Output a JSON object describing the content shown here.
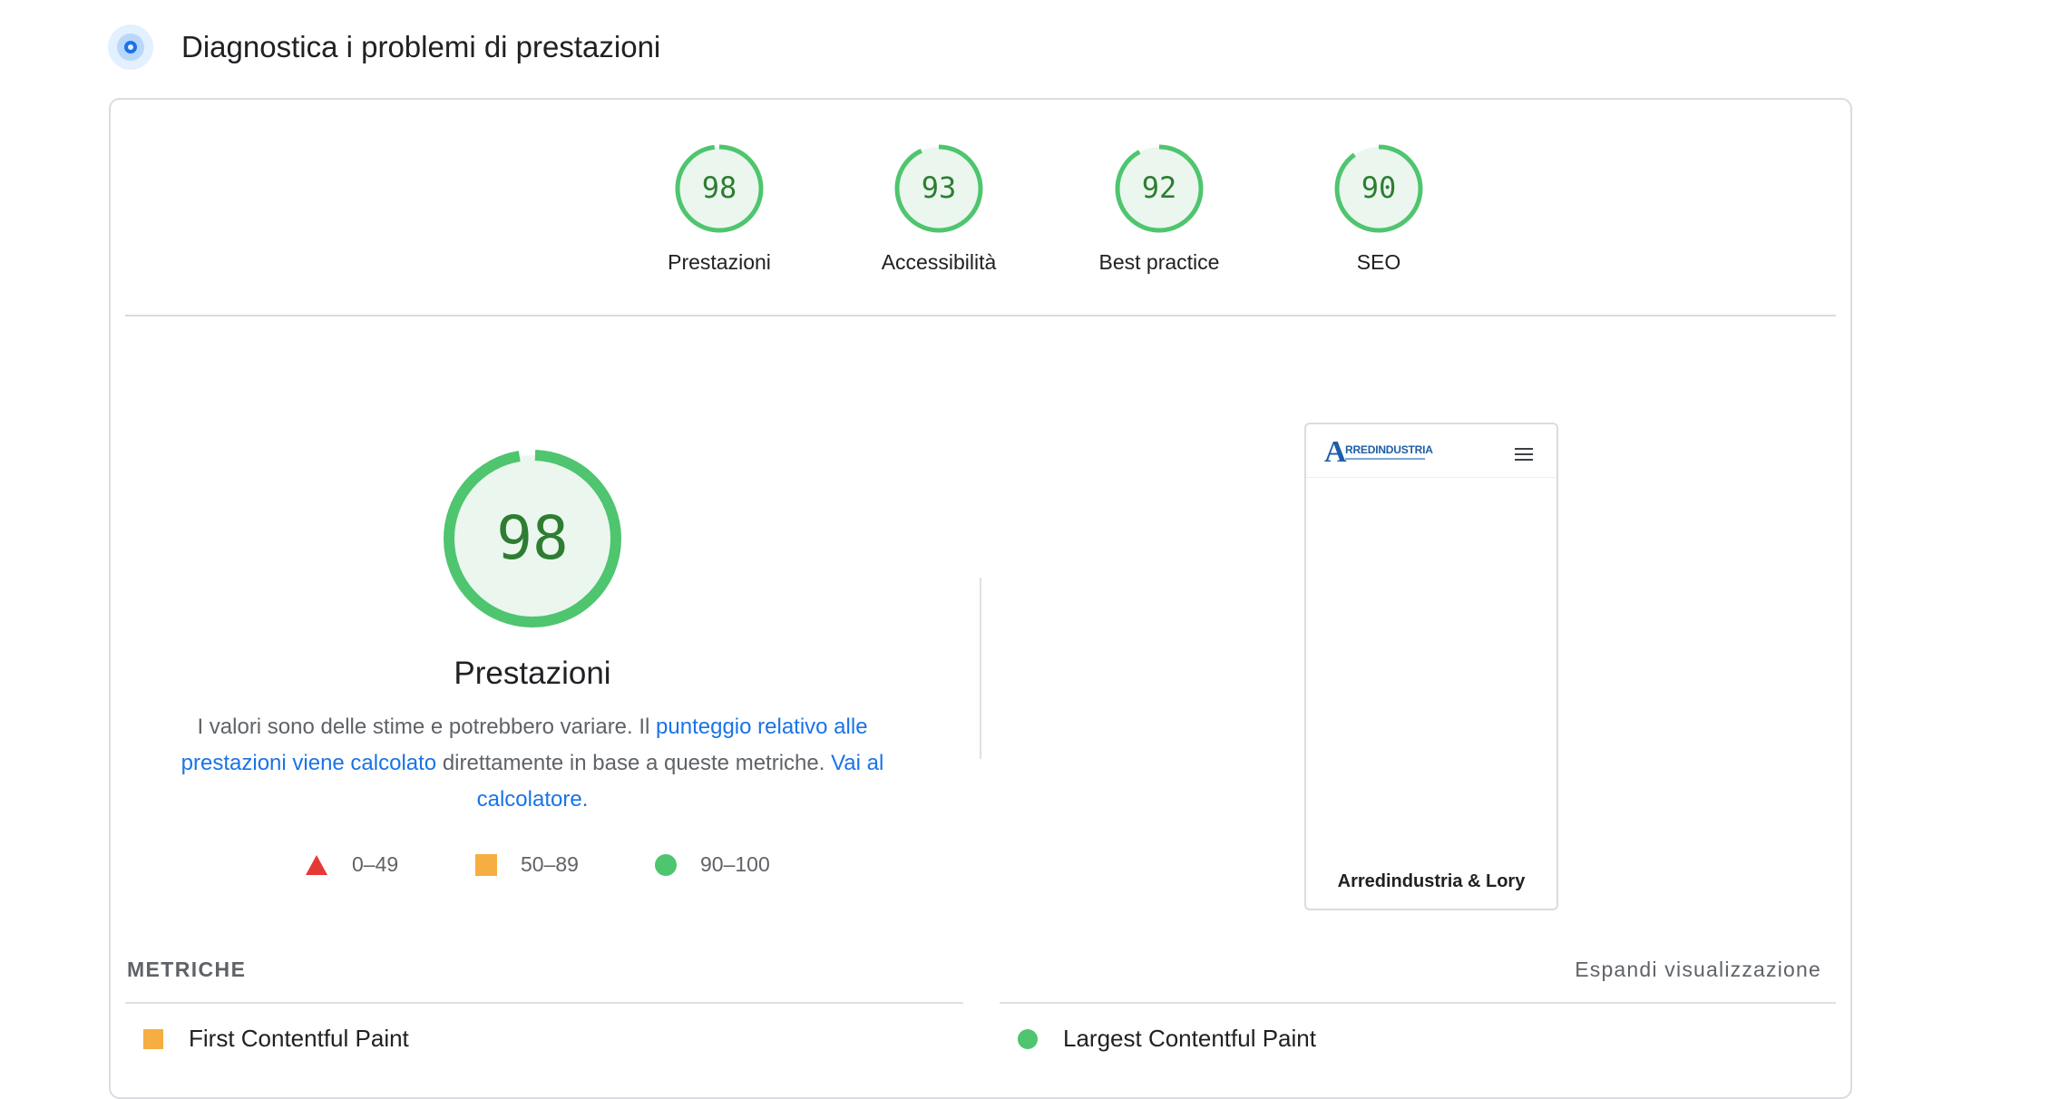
{
  "header": {
    "title": "Diagnostica i problemi di prestazioni",
    "icon": "lighthouse-target-icon"
  },
  "categories": [
    {
      "label": "Prestazioni",
      "score": 98
    },
    {
      "label": "Accessibilità",
      "score": 93
    },
    {
      "label": "Best practice",
      "score": 92
    },
    {
      "label": "SEO",
      "score": 90
    }
  ],
  "main_gauge": {
    "score": 98,
    "title": "Prestazioni"
  },
  "description": {
    "text1": "I valori sono delle stime e potrebbero variare. Il ",
    "link1": "punteggio relativo alle prestazioni viene calcolato",
    "text2": " direttamente in base a queste metriche. ",
    "link2": "Vai al calcolatore."
  },
  "legend": [
    {
      "label": "0–49",
      "shape": "triangle",
      "color": "#e53935"
    },
    {
      "label": "50–89",
      "shape": "square",
      "color": "#f6ad41"
    },
    {
      "label": "90–100",
      "shape": "circle",
      "color": "#4ec56e"
    }
  ],
  "screenshot": {
    "logo_letter": "A",
    "logo_text": "RREDINDUSTRIA",
    "footer": "Arredindustria & Lory"
  },
  "metrics": {
    "heading": "METRICHE",
    "expand_label": "Espandi visualizzazione",
    "items": [
      {
        "label": "First Contentful Paint",
        "status": "average"
      },
      {
        "label": "Largest Contentful Paint",
        "status": "good"
      }
    ]
  },
  "colors": {
    "pass": "#4ec56e",
    "pass_fill": "#ebf7ee",
    "pass_text": "#2e7d32",
    "link": "#1a73e8"
  }
}
